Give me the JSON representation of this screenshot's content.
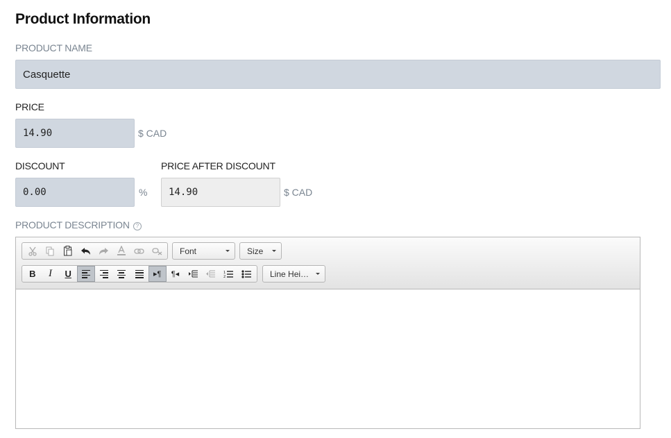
{
  "section": {
    "title": "Product Information"
  },
  "product_name": {
    "label": "PRODUCT NAME",
    "value": "Casquette"
  },
  "price": {
    "label": "PRICE",
    "value": "14.90",
    "unit": "$ CAD"
  },
  "discount": {
    "label": "DISCOUNT",
    "value": "0.00",
    "unit": "%"
  },
  "price_after_discount": {
    "label": "PRICE AFTER DISCOUNT",
    "value": "14.90",
    "unit": "$ CAD"
  },
  "description": {
    "label": "PRODUCT DESCRIPTION",
    "help_icon": "question-circle-icon",
    "toolbar": {
      "font_label": "Font",
      "size_label": "Size",
      "line_height_label": "Line Hei…",
      "bold": "B",
      "italic": "I",
      "underline": "U",
      "row1_icons": [
        "cut-icon",
        "copy-icon",
        "paste-icon",
        "undo-icon",
        "redo-icon",
        "font-color-icon",
        "link-icon",
        "unlink-icon"
      ],
      "row2_icons": [
        "bold-icon",
        "italic-icon",
        "underline-icon",
        "align-left-icon",
        "align-right-icon",
        "align-center-icon",
        "align-justify-icon",
        "ltr-icon",
        "rtl-icon",
        "indent-icon",
        "outdent-icon",
        "ordered-list-icon",
        "unordered-list-icon"
      ]
    },
    "content": ""
  }
}
